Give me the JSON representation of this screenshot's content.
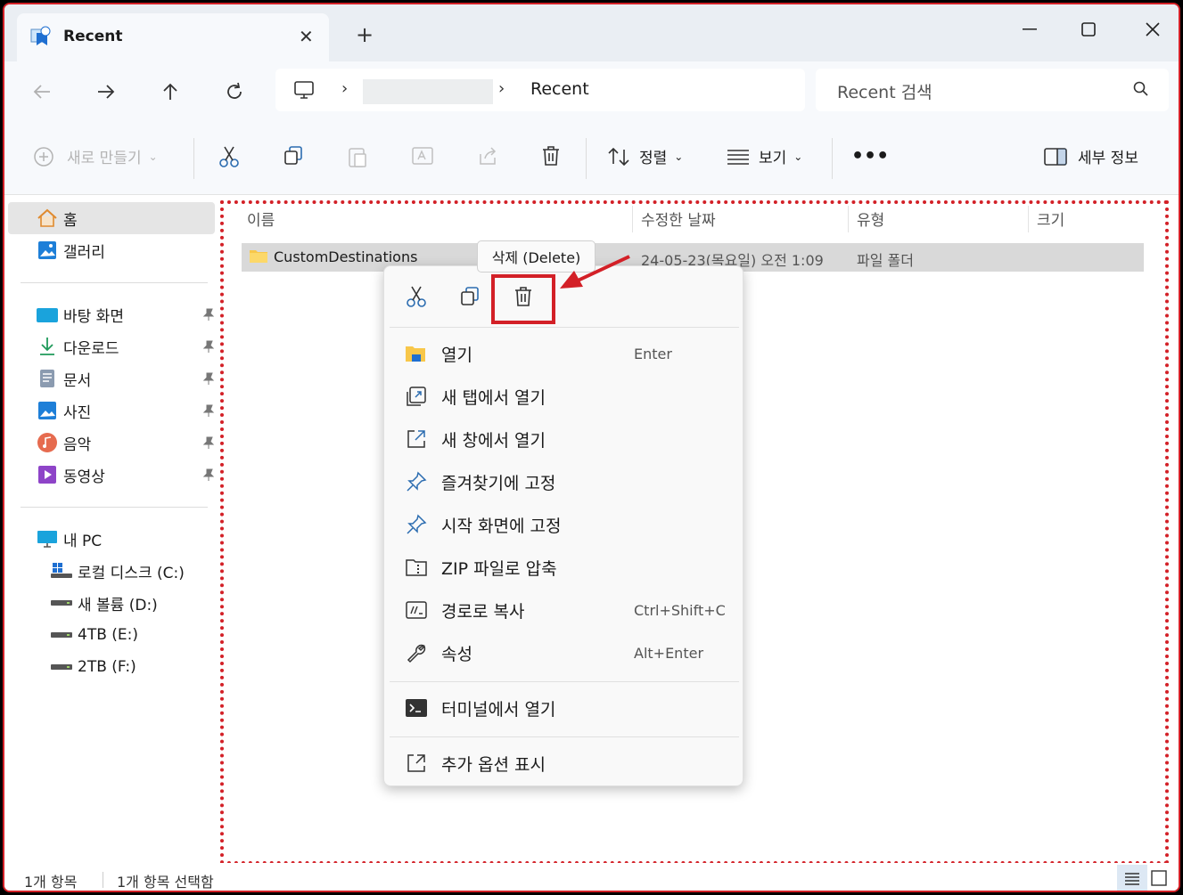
{
  "colors": {
    "accent": "#0067c0",
    "annotation": "#d32027",
    "folder": "#f8c74a"
  },
  "tab": {
    "title": "Recent"
  },
  "address": {
    "current": "Recent"
  },
  "search": {
    "placeholder": "Recent 검색"
  },
  "toolbar": {
    "new": "새로 만들기",
    "sort": "정렬",
    "view": "보기",
    "details": "세부 정보"
  },
  "sidebar": {
    "home": "홈",
    "gallery": "갤러리",
    "quick": [
      "바탕 화면",
      "다운로드",
      "문서",
      "사진",
      "음악",
      "동영상"
    ],
    "pc": "내 PC",
    "drives": [
      "로컬 디스크 (C:)",
      "새 볼륨 (D:)",
      "4TB (E:)",
      "2TB (F:)"
    ]
  },
  "columns": {
    "name": "이름",
    "modified": "수정한 날짜",
    "type": "유형",
    "size": "크기"
  },
  "row": {
    "name": "CustomDestinations",
    "modified": "24-05-23(목요일) 오전 1:09",
    "type": "파일 폴더"
  },
  "tooltip": "삭제 (Delete)",
  "menu": {
    "open": {
      "label": "열기",
      "shortcut": "Enter"
    },
    "open_tab": "새 탭에서 열기",
    "open_window": "새 창에서 열기",
    "pin_fav": "즐겨찾기에 고정",
    "pin_start": "시작 화면에 고정",
    "zip": "ZIP 파일로 압축",
    "copy_path": {
      "label": "경로로 복사",
      "shortcut": "Ctrl+Shift+C"
    },
    "properties": {
      "label": "속성",
      "shortcut": "Alt+Enter"
    },
    "terminal": "터미널에서 열기",
    "more": "추가 옵션 표시"
  },
  "status": {
    "count": "1개 항목",
    "selected": "1개 항목 선택함"
  }
}
